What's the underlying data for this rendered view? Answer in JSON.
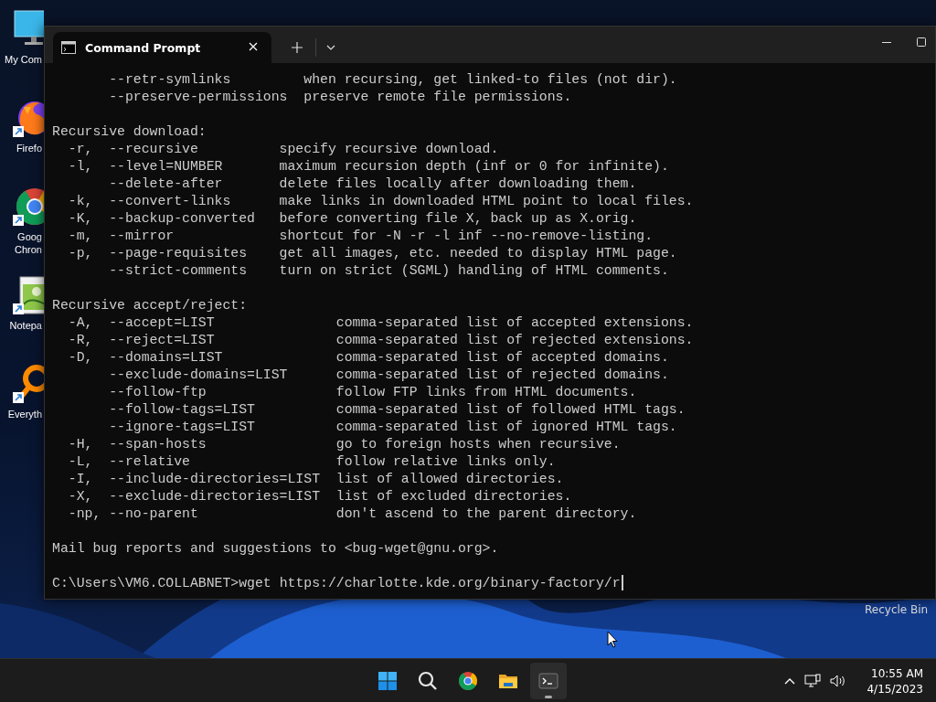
{
  "desktop": {
    "icons": [
      {
        "kind": "computer",
        "label": [
          "My Com"
        ],
        "shortcut": false
      },
      {
        "kind": "fox",
        "label": [
          "Firefo"
        ],
        "shortcut": true
      },
      {
        "kind": "chrome",
        "label": [
          "Goog",
          "Chron"
        ],
        "shortcut": true
      },
      {
        "kind": "notepad",
        "label": [
          "Notepa"
        ],
        "shortcut": true
      },
      {
        "kind": "finder",
        "label": [
          "Everyth"
        ],
        "shortcut": true
      }
    ],
    "recycle_label": "Recycle Bin"
  },
  "window": {
    "tabs": [
      {
        "title": "Command Prompt",
        "selected": true
      }
    ],
    "terminal": {
      "blocks": [
        {
          "kind": "section",
          "rows": [
            {
              "short": "",
              "long": "--retr-symlinks",
              "description": "when recursing, get linked-to files (not dir)."
            },
            {
              "short": "",
              "long": "--preserve-permissions",
              "description": "preserve remote file permissions."
            }
          ]
        },
        {
          "kind": "section",
          "heading": "Recursive download:",
          "rows": [
            {
              "short": "-r,",
              "long": "--recursive",
              "description": "specify recursive download."
            },
            {
              "short": "-l,",
              "long": "--level=NUMBER",
              "description": "maximum recursion depth (inf or 0 for infinite)."
            },
            {
              "short": "",
              "long": "--delete-after",
              "description": "delete files locally after downloading them."
            },
            {
              "short": "-k,",
              "long": "--convert-links",
              "description": "make links in downloaded HTML point to local files."
            },
            {
              "short": "-K,",
              "long": "--backup-converted",
              "description": "before converting file X, back up as X.orig."
            },
            {
              "short": "-m,",
              "long": "--mirror",
              "description": "shortcut for -N -r -l inf --no-remove-listing."
            },
            {
              "short": "-p,",
              "long": "--page-requisites",
              "description": "get all images, etc. needed to display HTML page."
            },
            {
              "short": "",
              "long": "--strict-comments",
              "description": "turn on strict (SGML) handling of HTML comments."
            }
          ]
        },
        {
          "kind": "section",
          "heading": "Recursive accept/reject:",
          "rows": [
            {
              "short": "-A,",
              "long": "--accept=LIST",
              "description": "comma-separated list of accepted extensions."
            },
            {
              "short": "-R,",
              "long": "--reject=LIST",
              "description": "comma-separated list of rejected extensions."
            },
            {
              "short": "-D,",
              "long": "--domains=LIST",
              "description": "comma-separated list of accepted domains."
            },
            {
              "short": "",
              "long": "--exclude-domains=LIST",
              "description": "comma-separated list of rejected domains."
            },
            {
              "short": "",
              "long": "--follow-ftp",
              "description": "follow FTP links from HTML documents."
            },
            {
              "short": "",
              "long": "--follow-tags=LIST",
              "description": "comma-separated list of followed HTML tags."
            },
            {
              "short": "",
              "long": "--ignore-tags=LIST",
              "description": "comma-separated list of ignored HTML tags."
            },
            {
              "short": "-H,",
              "long": "--span-hosts",
              "description": "go to foreign hosts when recursive."
            },
            {
              "short": "-L,",
              "long": "--relative",
              "description": "follow relative links only."
            },
            {
              "short": "-I,",
              "long": "--include-directories=LIST",
              "description": "list of allowed directories."
            },
            {
              "short": "-X,",
              "long": "--exclude-directories=LIST",
              "description": "list of excluded directories."
            },
            {
              "short": "-np,",
              "long": "--no-parent",
              "description": "don't ascend to the parent directory."
            }
          ]
        },
        {
          "kind": "text",
          "text": "Mail bug reports and suggestions to <bug-wget@gnu.org>."
        },
        {
          "kind": "prompt",
          "path": "C:\\Users\\VM6.COLLABNET>",
          "command": "wget https://charlotte.kde.org/binary-factory/r"
        }
      ]
    }
  },
  "taskbar": {
    "apps": [
      {
        "kind": "start",
        "active": false
      },
      {
        "kind": "search",
        "active": false
      },
      {
        "kind": "chrome",
        "active": false
      },
      {
        "kind": "folder",
        "active": false
      },
      {
        "kind": "terminal",
        "active": true
      }
    ],
    "time": "10:55 AM",
    "date": "4/15/2023"
  }
}
